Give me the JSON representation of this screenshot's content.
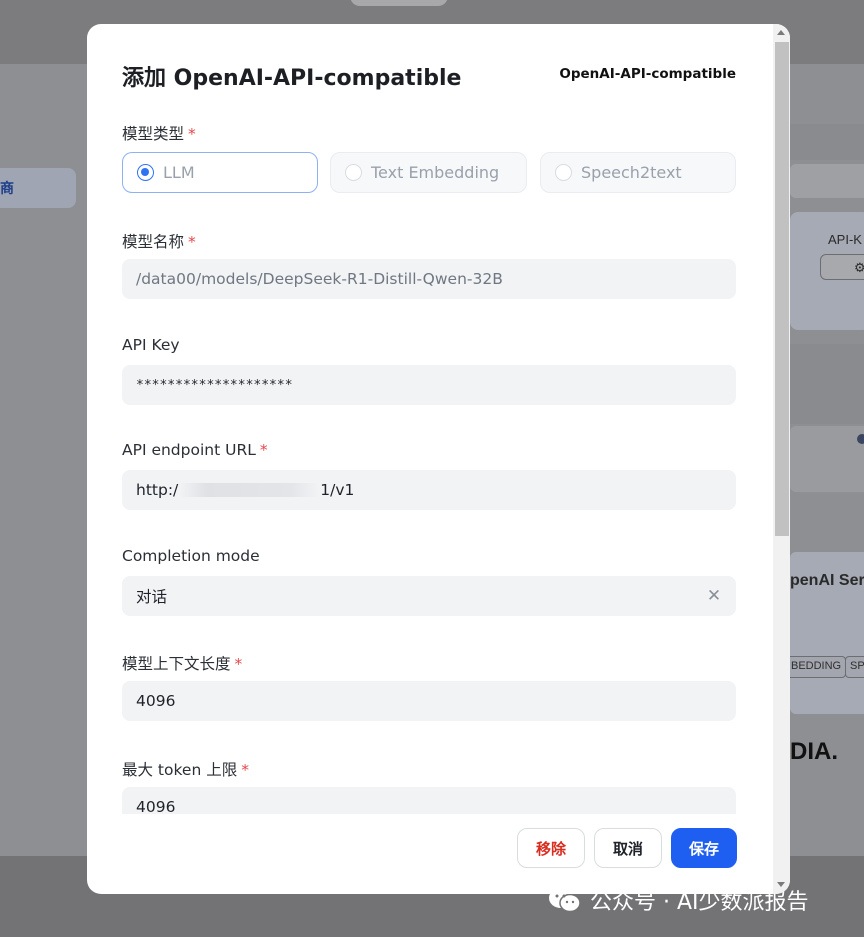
{
  "background": {
    "sidebar_item_label": "商",
    "right_panel": {
      "api_key_label": "API-K",
      "provider_name": "penAI Ser",
      "chips": [
        "BEDDING",
        "SP"
      ],
      "brand_text": "DIA."
    },
    "watermark": "公众号 · AI少数派报告"
  },
  "modal": {
    "title": "添加 OpenAI-API-compatible",
    "provider_badge": "OpenAI-API-compatible",
    "fields": {
      "model_type": {
        "label": "模型类型",
        "required": true,
        "options": [
          {
            "label": "LLM",
            "selected": true
          },
          {
            "label": "Text Embedding",
            "selected": false
          },
          {
            "label": "Speech2text",
            "selected": false
          }
        ]
      },
      "model_name": {
        "label": "模型名称",
        "required": true,
        "value": "/data00/models/DeepSeek-R1-Distill-Qwen-32B"
      },
      "api_key": {
        "label": "API Key",
        "required": false,
        "value": "********************"
      },
      "endpoint_url": {
        "label": "API endpoint URL",
        "required": true,
        "value_prefix": "http:/",
        "value_suffix": "1/v1"
      },
      "completion_mode": {
        "label": "Completion mode",
        "required": false,
        "value": "对话"
      },
      "context_length": {
        "label": "模型上下文长度",
        "required": true,
        "value": "4096"
      },
      "max_tokens": {
        "label": "最大 token 上限",
        "required": true,
        "value": "4096"
      }
    },
    "footer": {
      "remove_label": "移除",
      "cancel_label": "取消",
      "save_label": "保存"
    }
  },
  "colors": {
    "primary": "#1e5ff2",
    "danger": "#d92d20",
    "required_mark": "#e5484d",
    "input_bg": "#f2f3f5"
  }
}
